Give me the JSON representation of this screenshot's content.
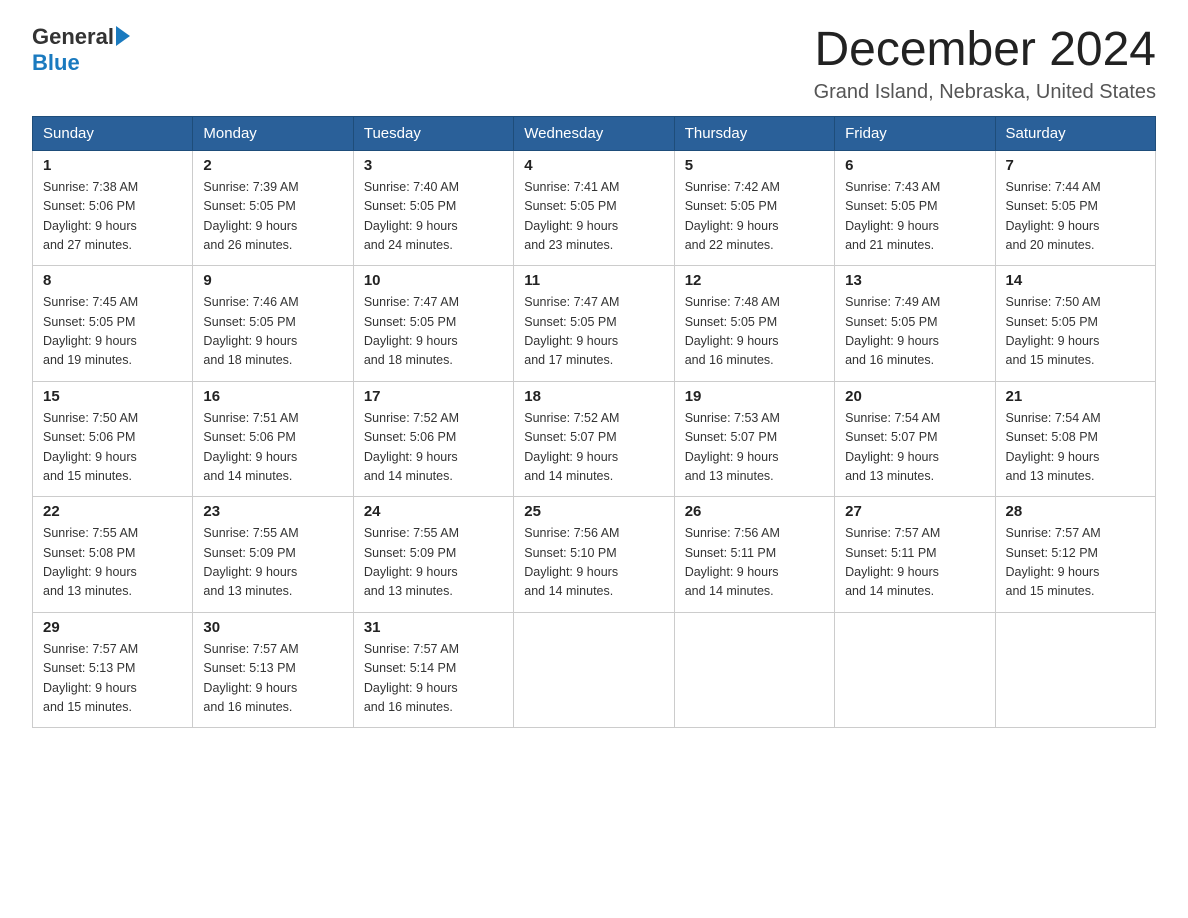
{
  "logo": {
    "general": "General",
    "blue": "Blue"
  },
  "title": "December 2024",
  "location": "Grand Island, Nebraska, United States",
  "days_of_week": [
    "Sunday",
    "Monday",
    "Tuesday",
    "Wednesday",
    "Thursday",
    "Friday",
    "Saturday"
  ],
  "weeks": [
    [
      {
        "day": "1",
        "sunrise": "7:38 AM",
        "sunset": "5:06 PM",
        "daylight": "9 hours and 27 minutes."
      },
      {
        "day": "2",
        "sunrise": "7:39 AM",
        "sunset": "5:05 PM",
        "daylight": "9 hours and 26 minutes."
      },
      {
        "day": "3",
        "sunrise": "7:40 AM",
        "sunset": "5:05 PM",
        "daylight": "9 hours and 24 minutes."
      },
      {
        "day": "4",
        "sunrise": "7:41 AM",
        "sunset": "5:05 PM",
        "daylight": "9 hours and 23 minutes."
      },
      {
        "day": "5",
        "sunrise": "7:42 AM",
        "sunset": "5:05 PM",
        "daylight": "9 hours and 22 minutes."
      },
      {
        "day": "6",
        "sunrise": "7:43 AM",
        "sunset": "5:05 PM",
        "daylight": "9 hours and 21 minutes."
      },
      {
        "day": "7",
        "sunrise": "7:44 AM",
        "sunset": "5:05 PM",
        "daylight": "9 hours and 20 minutes."
      }
    ],
    [
      {
        "day": "8",
        "sunrise": "7:45 AM",
        "sunset": "5:05 PM",
        "daylight": "9 hours and 19 minutes."
      },
      {
        "day": "9",
        "sunrise": "7:46 AM",
        "sunset": "5:05 PM",
        "daylight": "9 hours and 18 minutes."
      },
      {
        "day": "10",
        "sunrise": "7:47 AM",
        "sunset": "5:05 PM",
        "daylight": "9 hours and 18 minutes."
      },
      {
        "day": "11",
        "sunrise": "7:47 AM",
        "sunset": "5:05 PM",
        "daylight": "9 hours and 17 minutes."
      },
      {
        "day": "12",
        "sunrise": "7:48 AM",
        "sunset": "5:05 PM",
        "daylight": "9 hours and 16 minutes."
      },
      {
        "day": "13",
        "sunrise": "7:49 AM",
        "sunset": "5:05 PM",
        "daylight": "9 hours and 16 minutes."
      },
      {
        "day": "14",
        "sunrise": "7:50 AM",
        "sunset": "5:05 PM",
        "daylight": "9 hours and 15 minutes."
      }
    ],
    [
      {
        "day": "15",
        "sunrise": "7:50 AM",
        "sunset": "5:06 PM",
        "daylight": "9 hours and 15 minutes."
      },
      {
        "day": "16",
        "sunrise": "7:51 AM",
        "sunset": "5:06 PM",
        "daylight": "9 hours and 14 minutes."
      },
      {
        "day": "17",
        "sunrise": "7:52 AM",
        "sunset": "5:06 PM",
        "daylight": "9 hours and 14 minutes."
      },
      {
        "day": "18",
        "sunrise": "7:52 AM",
        "sunset": "5:07 PM",
        "daylight": "9 hours and 14 minutes."
      },
      {
        "day": "19",
        "sunrise": "7:53 AM",
        "sunset": "5:07 PM",
        "daylight": "9 hours and 13 minutes."
      },
      {
        "day": "20",
        "sunrise": "7:54 AM",
        "sunset": "5:07 PM",
        "daylight": "9 hours and 13 minutes."
      },
      {
        "day": "21",
        "sunrise": "7:54 AM",
        "sunset": "5:08 PM",
        "daylight": "9 hours and 13 minutes."
      }
    ],
    [
      {
        "day": "22",
        "sunrise": "7:55 AM",
        "sunset": "5:08 PM",
        "daylight": "9 hours and 13 minutes."
      },
      {
        "day": "23",
        "sunrise": "7:55 AM",
        "sunset": "5:09 PM",
        "daylight": "9 hours and 13 minutes."
      },
      {
        "day": "24",
        "sunrise": "7:55 AM",
        "sunset": "5:09 PM",
        "daylight": "9 hours and 13 minutes."
      },
      {
        "day": "25",
        "sunrise": "7:56 AM",
        "sunset": "5:10 PM",
        "daylight": "9 hours and 14 minutes."
      },
      {
        "day": "26",
        "sunrise": "7:56 AM",
        "sunset": "5:11 PM",
        "daylight": "9 hours and 14 minutes."
      },
      {
        "day": "27",
        "sunrise": "7:57 AM",
        "sunset": "5:11 PM",
        "daylight": "9 hours and 14 minutes."
      },
      {
        "day": "28",
        "sunrise": "7:57 AM",
        "sunset": "5:12 PM",
        "daylight": "9 hours and 15 minutes."
      }
    ],
    [
      {
        "day": "29",
        "sunrise": "7:57 AM",
        "sunset": "5:13 PM",
        "daylight": "9 hours and 15 minutes."
      },
      {
        "day": "30",
        "sunrise": "7:57 AM",
        "sunset": "5:13 PM",
        "daylight": "9 hours and 16 minutes."
      },
      {
        "day": "31",
        "sunrise": "7:57 AM",
        "sunset": "5:14 PM",
        "daylight": "9 hours and 16 minutes."
      },
      null,
      null,
      null,
      null
    ]
  ],
  "labels": {
    "sunrise": "Sunrise:",
    "sunset": "Sunset:",
    "daylight": "Daylight:"
  }
}
